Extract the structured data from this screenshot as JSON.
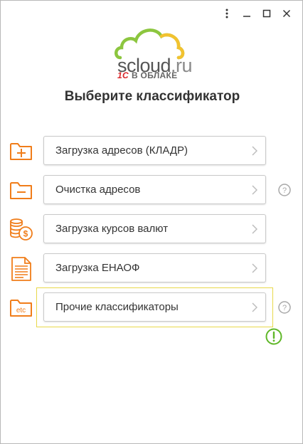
{
  "window_controls": {
    "menu_icon": "more-vert-icon",
    "minimize_icon": "minimize-icon",
    "maximize_icon": "maximize-icon",
    "close_icon": "close-icon"
  },
  "logo": {
    "brand_main": "scloud",
    "brand_tld": ".ru",
    "onec": "1С",
    "subtitle": "В ОБЛАКЕ"
  },
  "heading": "Выберите классификатор",
  "actions": [
    {
      "label": "Загрузка адресов (КЛАДР)",
      "icon": "folder-plus-icon",
      "has_help": false
    },
    {
      "label": "Очистка адресов",
      "icon": "folder-minus-icon",
      "has_help": true
    },
    {
      "label": "Загрузка курсов валют",
      "icon": "coins-icon",
      "has_help": false
    },
    {
      "label": "Загрузка ЕНАОФ",
      "icon": "document-icon",
      "has_help": false
    },
    {
      "label": "Прочие классификаторы",
      "icon": "folder-etc-icon",
      "has_help": true
    }
  ],
  "etc_icon_text": "etc",
  "colors": {
    "accent_orange": "#f07d1a",
    "help_gray": "#a8a8a8",
    "warning_green": "#5fb728",
    "focus_yellow": "#e8d84a",
    "cloud_green": "#8cc63f",
    "cloud_yellow": "#f2c230"
  }
}
